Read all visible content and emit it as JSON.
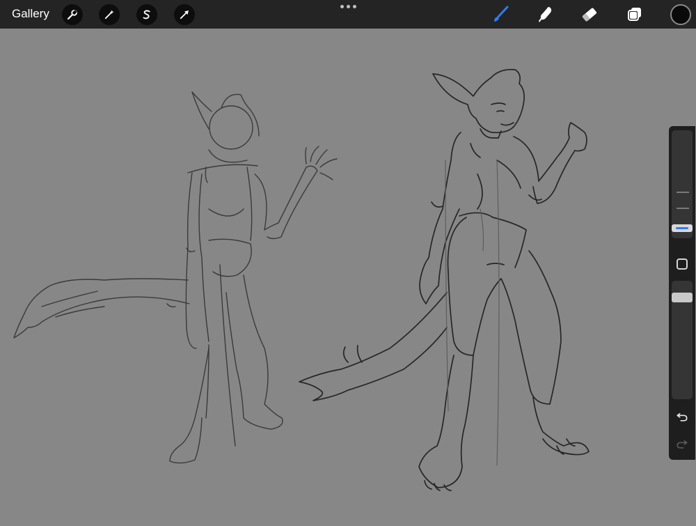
{
  "app": {
    "gallery_label": "Gallery"
  },
  "toolbar": {
    "left_tools": [
      {
        "name": "actions",
        "icon": "wrench-icon"
      },
      {
        "name": "adjustments",
        "icon": "magic-wand-icon"
      },
      {
        "name": "selection",
        "icon": "selection-s-icon"
      },
      {
        "name": "transform",
        "icon": "arrow-cursor-icon"
      }
    ],
    "right_tools": [
      {
        "name": "brush",
        "icon": "brush-icon",
        "active": true
      },
      {
        "name": "smudge",
        "icon": "smudge-finger-icon",
        "active": false
      },
      {
        "name": "eraser",
        "icon": "eraser-icon",
        "active": false
      },
      {
        "name": "layers",
        "icon": "layers-icon",
        "active": false
      }
    ],
    "current_color": "#0a0a0a"
  },
  "colors": {
    "canvas_background": "#878787",
    "toolbar_background": "#242424",
    "accent": "#2f7df6",
    "sketch_stroke": "#2b2b2b"
  },
  "sidebar": {
    "brush_size_level": 0.22,
    "opacity_level": 0.9
  }
}
